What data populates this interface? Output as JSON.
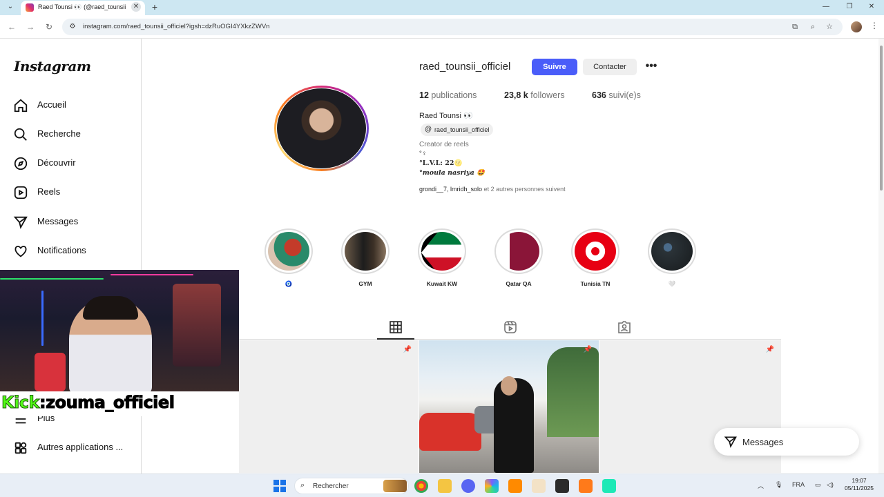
{
  "browser": {
    "tab_title": "Raed Tounsi 👀 (@raed_tounsii",
    "url": "instagram.com/raed_tounsii_officiel?igsh=dzRuOGI4YXkzZWVn"
  },
  "sidebar": {
    "logo": "Instagram",
    "items": [
      {
        "label": "Accueil",
        "icon": "home-icon"
      },
      {
        "label": "Recherche",
        "icon": "search-icon"
      },
      {
        "label": "Découvrir",
        "icon": "compass-icon"
      },
      {
        "label": "Reels",
        "icon": "reels-icon"
      },
      {
        "label": "Messages",
        "icon": "messages-icon"
      },
      {
        "label": "Notifications",
        "icon": "heart-icon"
      }
    ],
    "more_label": "Plus",
    "apps_label": "Autres applications ..."
  },
  "profile": {
    "username": "raed_tounsii_officiel",
    "follow_label": "Suivre",
    "contact_label": "Contacter",
    "more_label": "•••",
    "stats": {
      "posts_count": "12",
      "posts_label": "publications",
      "followers_count": "23,8 k",
      "followers_label": "followers",
      "following_count": "636",
      "following_label": "suivi(e)s"
    },
    "full_name": "Raed Tounsi 👀",
    "threads_handle": "raed_tounsii_officiel",
    "category": "Creator de reels",
    "bio": [
      "°♀",
      "°L.V.L: 22🌝",
      "°moula nasriya 🤩"
    ],
    "followed_by_users": "grondi__7, lmridh_solo",
    "followed_by_rest": " et 2 autres personnes suivent"
  },
  "highlights": [
    {
      "label": "🧿"
    },
    {
      "label": "GYM"
    },
    {
      "label": "Kuwait KW"
    },
    {
      "label": "Qatar QA"
    },
    {
      "label": "Tunisia TN"
    },
    {
      "label": "🤍"
    }
  ],
  "overlay": {
    "kick_prefix": "Kick",
    "kick_handle": ":zouma_officiel"
  },
  "messages_pill": {
    "label": "Messages"
  },
  "taskbar": {
    "search_placeholder": "Rechercher",
    "language": "FRA",
    "time": "19:07",
    "date": "05/11/2025"
  }
}
